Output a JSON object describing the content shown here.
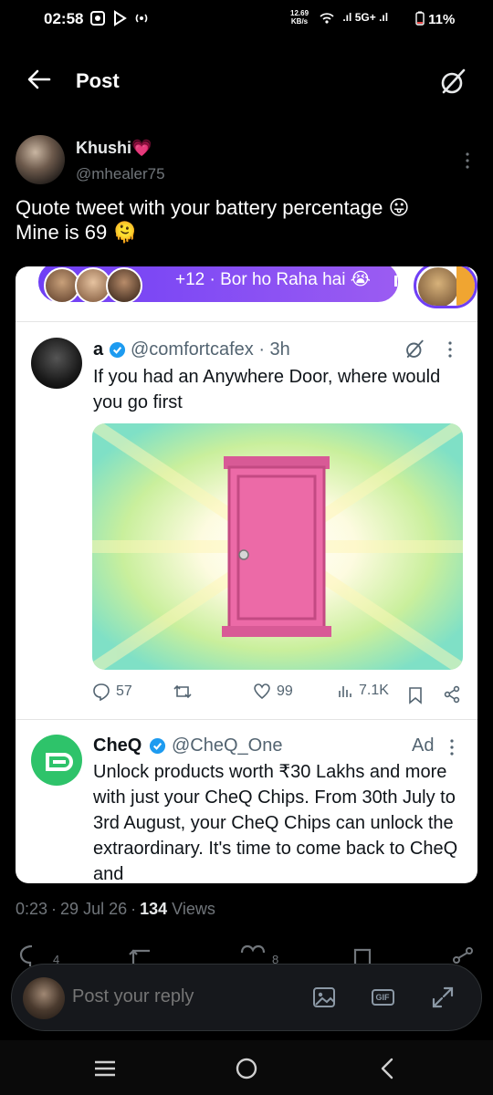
{
  "status_bar": {
    "time": "02:58",
    "net_speed_value": "12.69",
    "net_speed_unit": "KB/s",
    "network": "5G+",
    "battery": "11%"
  },
  "header": {
    "title": "Post"
  },
  "tweet": {
    "author_name": "Khushi",
    "author_emoji": "💗",
    "handle": "@mhealer75",
    "text_line1": "Quote tweet with your battery percentage 😛",
    "text_line2": "Mine is 69 🫠",
    "time": "0:23",
    "date": "29 Jul 26",
    "views_count": "134",
    "views_label": "Views",
    "reply_count": "4",
    "like_count": "8"
  },
  "screenshot": {
    "spaces": {
      "count_text": "+12",
      "dot": "·",
      "title": "Bor ho Raha hai 😭"
    },
    "quoted": {
      "name": "a",
      "handle_time": "@comfortcafex · 3h",
      "text": "If you had an Anywhere Door, where would you go first",
      "replies": "57",
      "likes": "99",
      "views": "7.1K"
    },
    "ad": {
      "name": "CheQ",
      "handle": "@CheQ_One",
      "label": "Ad",
      "text": "Unlock products worth ₹30 Lakhs and more with just your CheQ Chips. From 30th July to 3rd August, your CheQ Chips can unlock the extraordinary. It's time to come back to CheQ and"
    }
  },
  "reply_bar": {
    "placeholder": "Post your reply",
    "gif_label": "GIF"
  },
  "colors": {
    "background": "#000000",
    "text_primary": "#e7e9ea",
    "text_secondary": "#71767b",
    "spaces_purple": "#7b47f2",
    "verified_blue": "#1d9bf0",
    "cheq_green": "#2ec36a",
    "door_pink": "#ec6aa7"
  },
  "icons": {
    "back": "arrow-left-icon",
    "grok": "grok-icon",
    "more": "more-vertical-icon",
    "reply": "reply-icon",
    "retweet": "retweet-icon",
    "like": "heart-icon",
    "views": "views-icon",
    "bookmark": "bookmark-icon",
    "share": "share-icon",
    "image": "image-icon",
    "gif": "gif-icon",
    "expand": "expand-icon",
    "nav_menu": "menu-icon",
    "nav_home": "home-circle-icon",
    "nav_back": "chevron-left-icon"
  }
}
